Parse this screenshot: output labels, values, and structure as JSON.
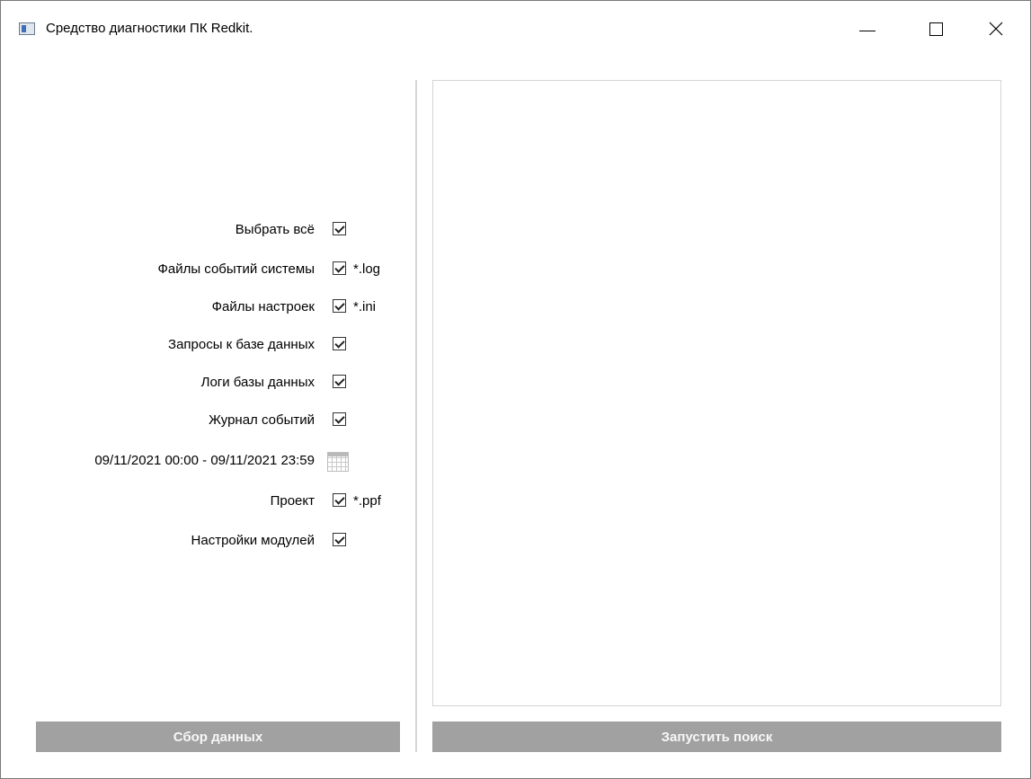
{
  "window": {
    "title": "Средство диагностики ПК Redkit."
  },
  "options": {
    "select_all": {
      "label": "Выбрать всё",
      "checked": true
    },
    "system_logs": {
      "label": "Файлы событий системы",
      "ext": "*.log",
      "checked": true
    },
    "settings_files": {
      "label": "Файлы настроек",
      "ext": "*.ini",
      "checked": true
    },
    "db_queries": {
      "label": "Запросы к базе данных",
      "checked": true
    },
    "db_logs": {
      "label": "Логи базы данных",
      "checked": true
    },
    "event_journal": {
      "label": "Журнал событий",
      "checked": true
    },
    "date_range": "09/11/2021 00:00 - 09/11/2021 23:59",
    "project": {
      "label": "Проект",
      "ext": "*.ppf",
      "checked": true
    },
    "module_settings": {
      "label": "Настройки модулей",
      "checked": true
    }
  },
  "buttons": {
    "collect": "Сбор данных",
    "search": "Запустить поиск"
  },
  "colors": {
    "button_bg": "#a1a1a1",
    "button_text": "#f7f7f7",
    "border": "#d4d4d4"
  }
}
